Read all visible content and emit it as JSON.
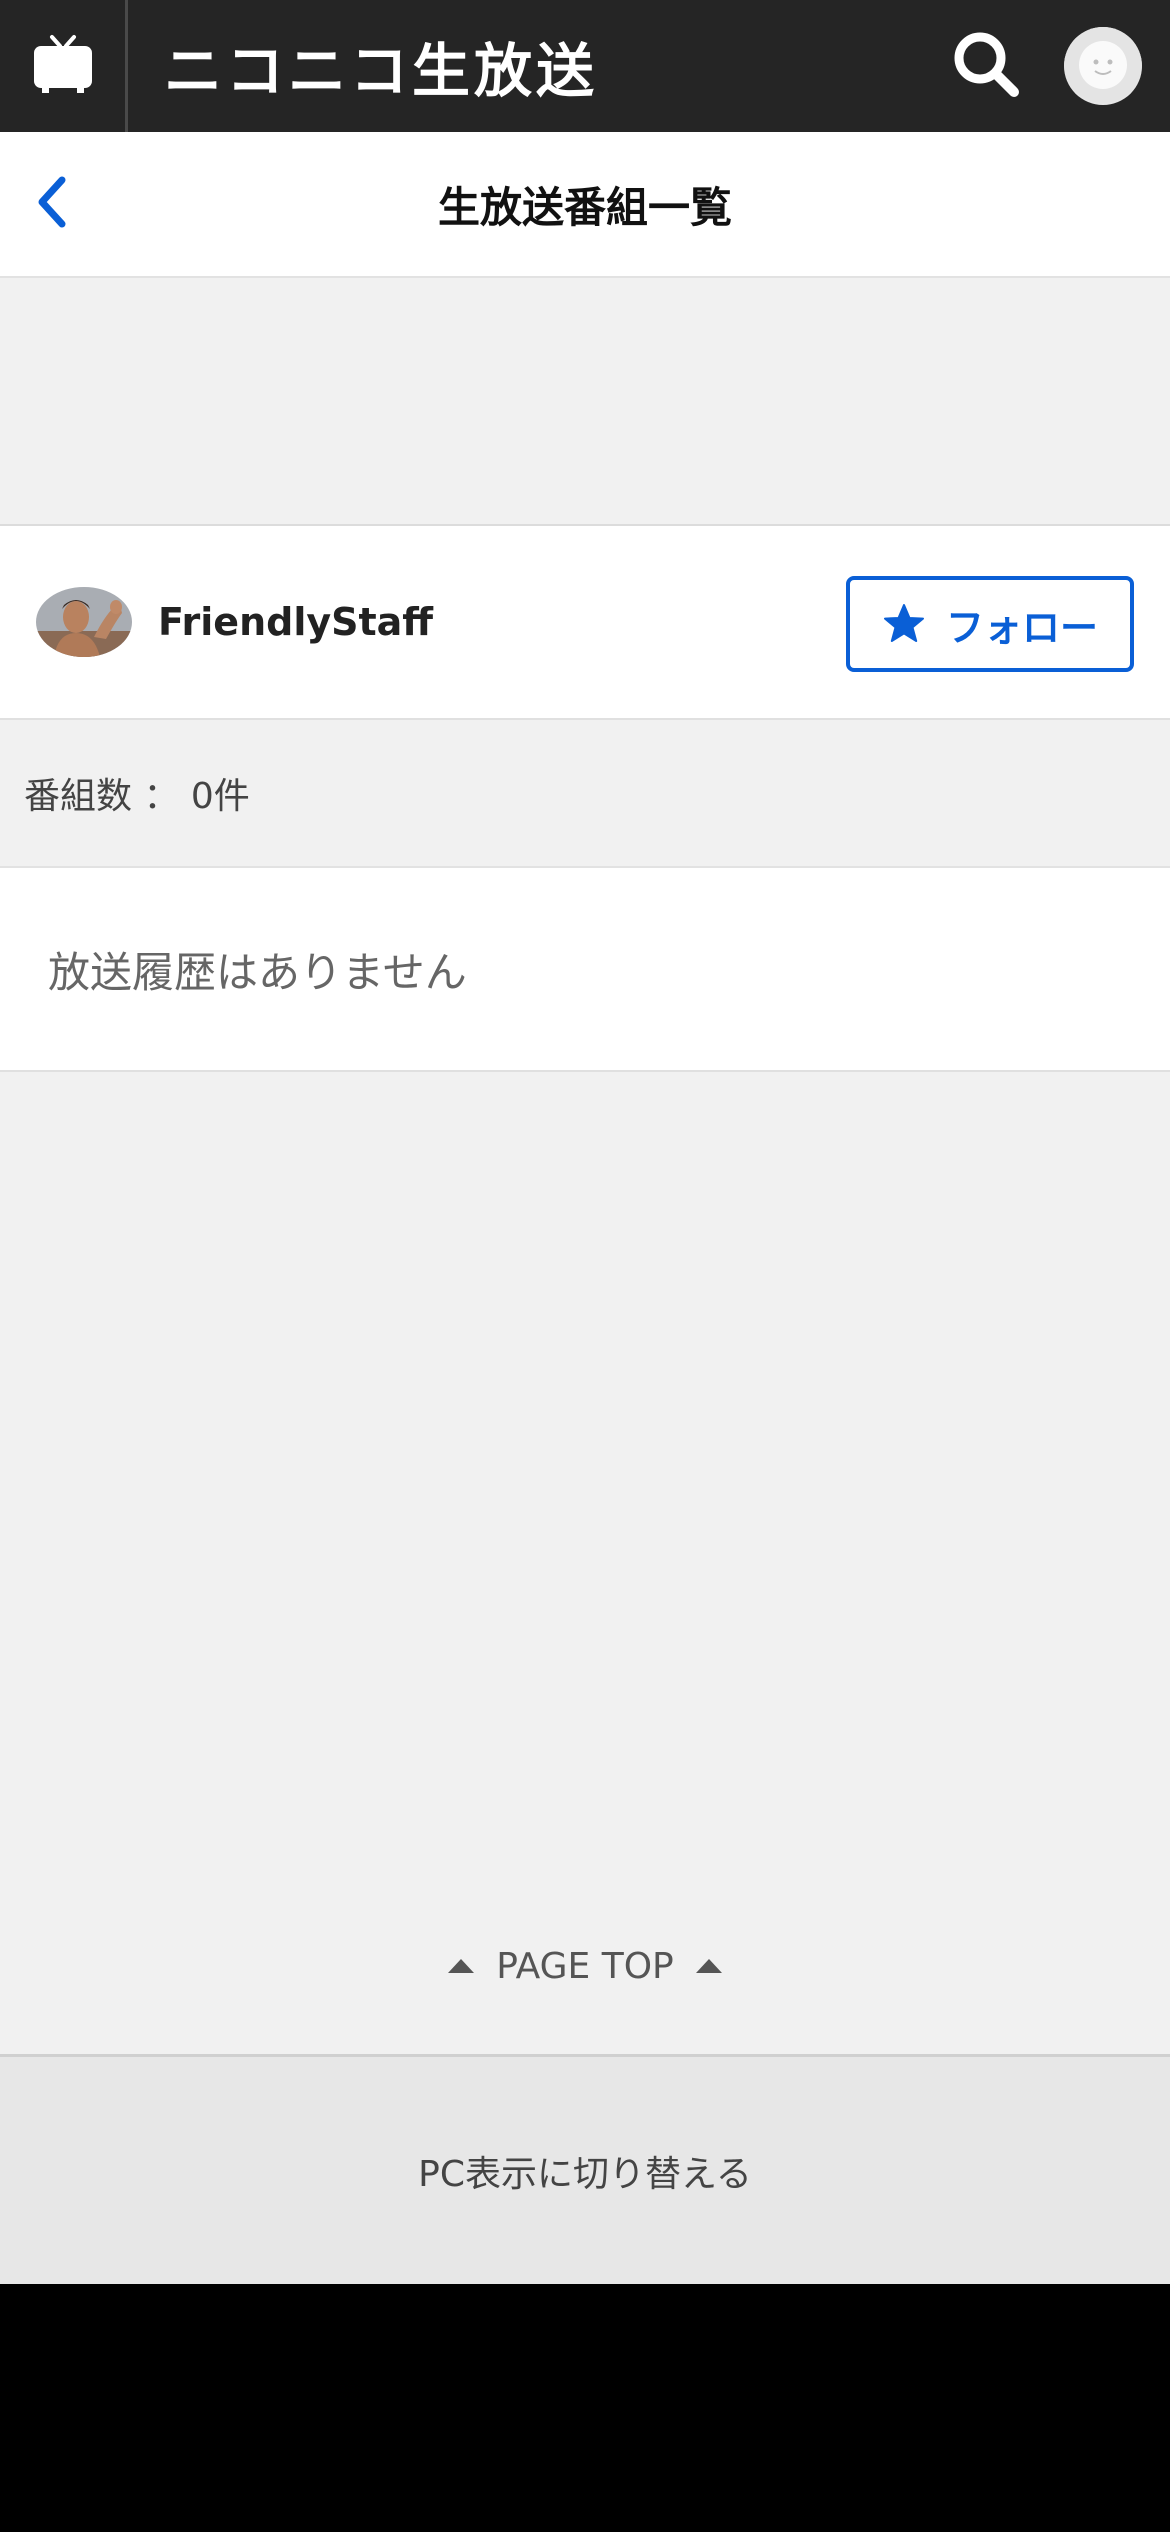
{
  "header": {
    "logo_text": "ニコニコ生放送",
    "icons": {
      "tv": "tv-icon",
      "search": "search-icon",
      "avatar": "user-avatar-icon"
    },
    "background": "#252525"
  },
  "title_bar": {
    "title": "生放送番組一覧",
    "back_icon": "chevron-left-icon"
  },
  "channel": {
    "name": "FriendlyStaff",
    "follow_label": "フォロー",
    "follow_icon": "star-icon",
    "accent": "#0a5fd6"
  },
  "program_count": {
    "text": "番組数 ： 0件"
  },
  "empty_message": "放送履歴はありません",
  "page_top": {
    "label": "PAGE TOP"
  },
  "pc_switch": {
    "label": "PC表示に切り替える"
  }
}
